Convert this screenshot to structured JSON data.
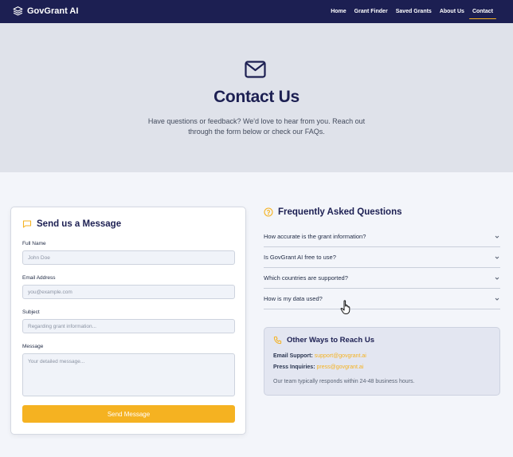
{
  "nav": {
    "brand": "GovGrant AI",
    "links": [
      "Home",
      "Grant Finder",
      "Saved Grants",
      "About Us",
      "Contact"
    ],
    "active": "Contact"
  },
  "hero": {
    "title": "Contact Us",
    "subtitle_line1": "Have questions or feedback? We'd love to hear from you. Reach out",
    "subtitle_line2": "through the form below or check our FAQs.",
    "icon": "mail-icon"
  },
  "form": {
    "title": "Send us a Message",
    "icon": "message-square-icon",
    "full_name": {
      "label": "Full Name",
      "placeholder": "John Doe"
    },
    "email": {
      "label": "Email Address",
      "placeholder": "you@example.com"
    },
    "subject": {
      "label": "Subject",
      "placeholder": "Regarding grant information..."
    },
    "message": {
      "label": "Message",
      "placeholder": "Your detailed message..."
    },
    "submit_label": "Send Message"
  },
  "faq": {
    "title": "Frequently Asked Questions",
    "icon": "help-circle-icon",
    "items": [
      "How accurate is the grant information?",
      "Is GovGrant AI free to use?",
      "Which countries are supported?",
      "How is my data used?"
    ]
  },
  "other_ways": {
    "title": "Other Ways to Reach Us",
    "icon": "phone-icon",
    "email_support_label": "Email Support:",
    "email_support_value": "support@govgrant.ai",
    "press_label": "Press Inquiries:",
    "press_value": "press@govgrant.ai",
    "note": "Our team typically responds within 24-48 business hours."
  },
  "colors": {
    "navy": "#1c1f52",
    "accent": "#f5b221",
    "hero_bg": "#dfe2ea",
    "page_bg": "#f3f5fa"
  }
}
